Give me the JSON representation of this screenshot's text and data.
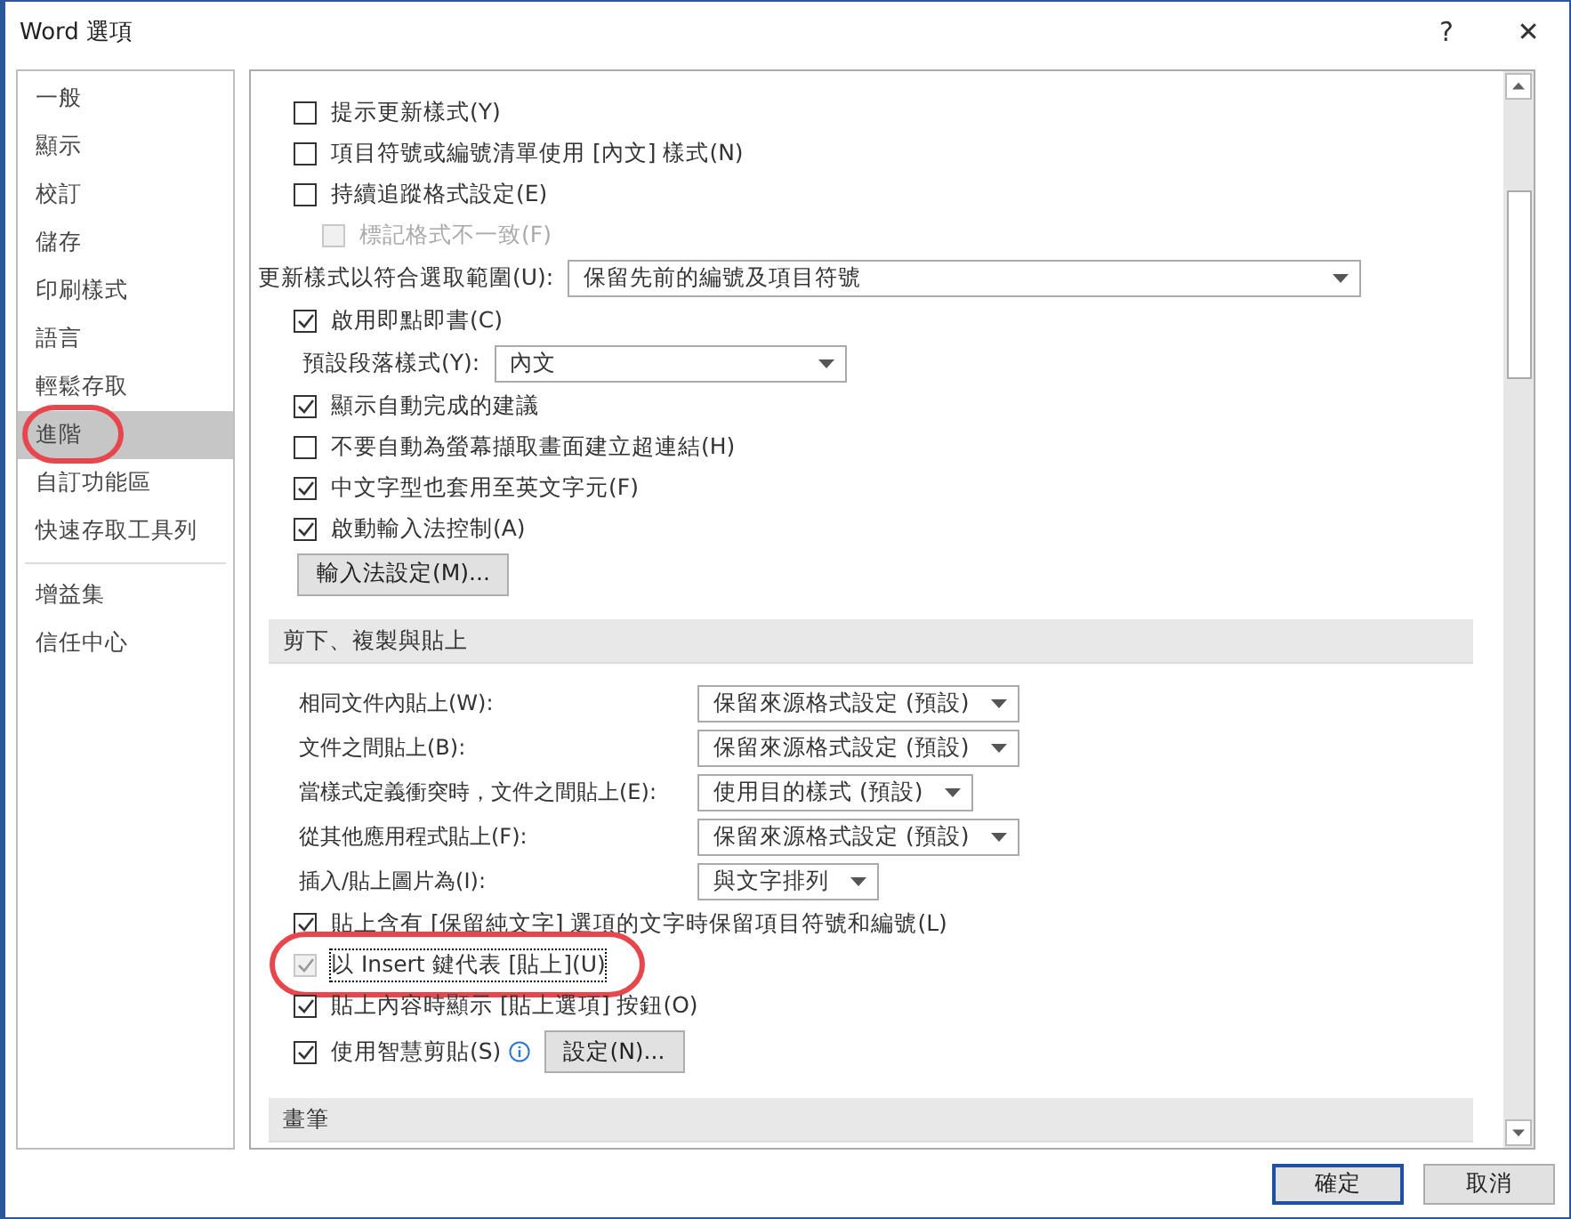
{
  "window": {
    "title": "Word 選項",
    "help": "?",
    "close": "✕"
  },
  "sidebar": {
    "groups": [
      [
        {
          "label": "一般",
          "selected": false,
          "circled": false
        },
        {
          "label": "顯示",
          "selected": false,
          "circled": false
        },
        {
          "label": "校訂",
          "selected": false,
          "circled": false
        },
        {
          "label": "儲存",
          "selected": false,
          "circled": false
        },
        {
          "label": "印刷樣式",
          "selected": false,
          "circled": false
        },
        {
          "label": "語言",
          "selected": false,
          "circled": false
        },
        {
          "label": "輕鬆存取",
          "selected": false,
          "circled": false
        },
        {
          "label": "進階",
          "selected": true,
          "circled": true
        },
        {
          "label": "自訂功能區",
          "selected": false,
          "circled": false
        },
        {
          "label": "快速存取工具列",
          "selected": false,
          "circled": false
        }
      ],
      [
        {
          "label": "增益集",
          "selected": false,
          "circled": false
        },
        {
          "label": "信任中心",
          "selected": false,
          "circled": false
        }
      ]
    ]
  },
  "options": [
    {
      "kind": "checkbox",
      "label": "提示更新樣式(Y)",
      "checked": false,
      "disabled": false,
      "indented": false,
      "focused": false,
      "circled": false
    },
    {
      "kind": "checkbox",
      "label": "項目符號或編號清單使用 [內文] 樣式(N)",
      "checked": false,
      "disabled": false,
      "indented": false,
      "focused": false,
      "circled": false
    },
    {
      "kind": "checkbox",
      "label": "持續追蹤格式設定(E)",
      "checked": false,
      "disabled": false,
      "indented": false,
      "focused": false,
      "circled": false
    },
    {
      "kind": "checkbox",
      "label": "標記格式不一致(F)",
      "checked": false,
      "disabled": true,
      "indented": true,
      "focused": false,
      "circled": false
    },
    {
      "kind": "dropdown",
      "label": "更新樣式以符合選取範圍(U):",
      "value": "保留先前的編號及項目符號",
      "indented": false
    },
    {
      "kind": "checkbox",
      "label": "啟用即點即書(C)",
      "checked": true,
      "disabled": false,
      "indented": false,
      "focused": false,
      "circled": false
    },
    {
      "kind": "dropdown",
      "label": "預設段落樣式(Y):",
      "value": "內文",
      "indented": true
    },
    {
      "kind": "checkbox",
      "label": "顯示自動完成的建議",
      "checked": true,
      "disabled": false,
      "indented": false,
      "focused": false,
      "circled": false
    },
    {
      "kind": "checkbox",
      "label": "不要自動為螢幕擷取畫面建立超連結(H)",
      "checked": false,
      "disabled": false,
      "indented": false,
      "focused": false,
      "circled": false
    },
    {
      "kind": "checkbox",
      "label": "中文字型也套用至英文字元(F)",
      "checked": true,
      "disabled": false,
      "indented": false,
      "focused": false,
      "circled": false
    },
    {
      "kind": "checkbox",
      "label": "啟動輸入法控制(A)",
      "checked": true,
      "disabled": false,
      "indented": false,
      "focused": false,
      "circled": false
    },
    {
      "kind": "button",
      "label": "輸入法設定(M)..."
    },
    {
      "kind": "section",
      "title": "剪下、複製與貼上"
    },
    {
      "kind": "paste-dropdown",
      "label": "相同文件內貼上(W):",
      "value": "保留來源格式設定 (預設)"
    },
    {
      "kind": "paste-dropdown",
      "label": "文件之間貼上(B):",
      "value": "保留來源格式設定 (預設)"
    },
    {
      "kind": "paste-dropdown",
      "label": "當樣式定義衝突時，文件之間貼上(E):",
      "value": "使用目的樣式 (預設)"
    },
    {
      "kind": "paste-dropdown",
      "label": "從其他應用程式貼上(F):",
      "value": "保留來源格式設定 (預設)"
    },
    {
      "kind": "paste-dropdown",
      "label": "插入/貼上圖片為(I):",
      "value": "與文字排列"
    },
    {
      "kind": "checkbox",
      "label": "貼上含有 [保留純文字] 選項的文字時保留項目符號和編號(L)",
      "checked": true,
      "disabled": false,
      "indented": false,
      "focused": false,
      "circled": false
    },
    {
      "kind": "checkbox",
      "label": "以 Insert 鍵代表 [貼上](U)",
      "checked": true,
      "disabled": true,
      "indented": false,
      "focused": true,
      "circled": true
    },
    {
      "kind": "checkbox",
      "label": "貼上內容時顯示 [貼上選項] 按鈕(O)",
      "checked": true,
      "disabled": false,
      "indented": false,
      "focused": false,
      "circled": false
    },
    {
      "kind": "checkbox-button",
      "label": "使用智慧剪貼(S)",
      "checked": true,
      "button": "設定(N)..."
    },
    {
      "kind": "section",
      "title": "畫筆"
    }
  ],
  "footer": {
    "ok": "確定",
    "cancel": "取消"
  }
}
